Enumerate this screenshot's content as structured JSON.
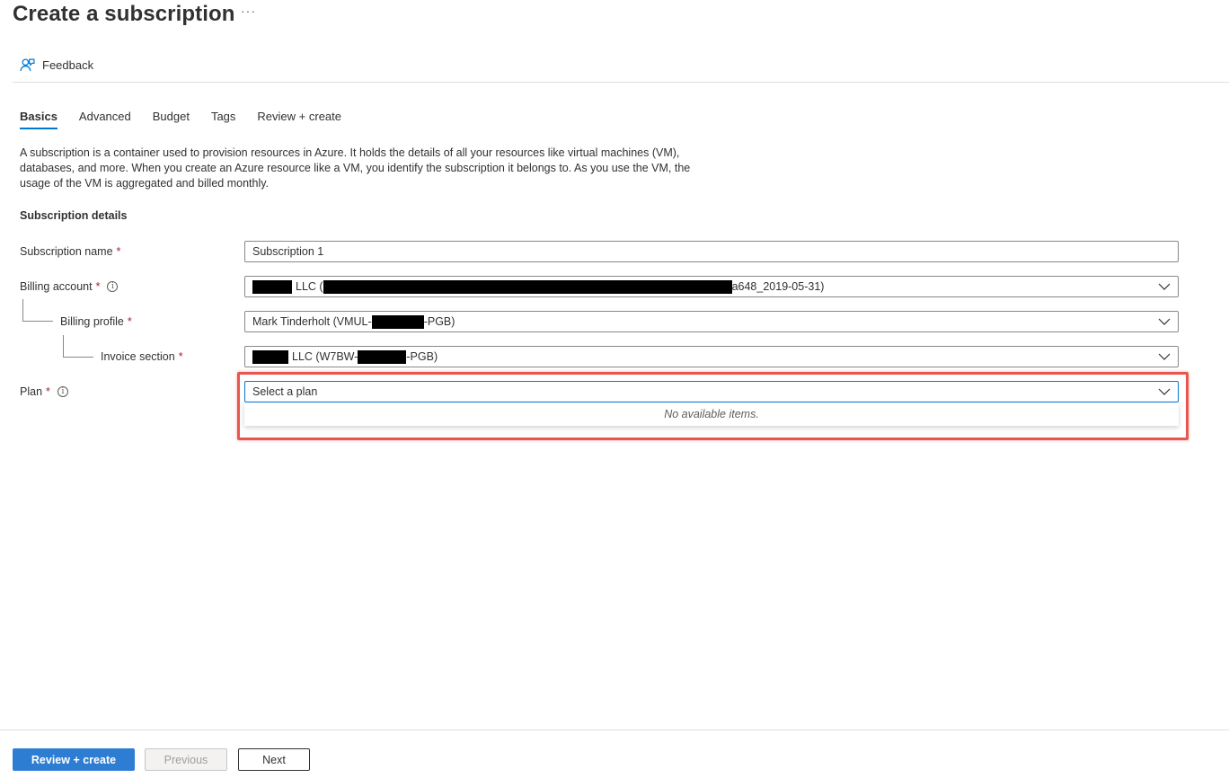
{
  "page": {
    "title": "Create a subscription",
    "more_label": "···"
  },
  "toolbar": {
    "feedback_label": "Feedback"
  },
  "tabs": [
    {
      "label": "Basics",
      "active": true
    },
    {
      "label": "Advanced",
      "active": false
    },
    {
      "label": "Budget",
      "active": false
    },
    {
      "label": "Tags",
      "active": false
    },
    {
      "label": "Review + create",
      "active": false
    }
  ],
  "description": "A subscription is a container used to provision resources in Azure. It holds the details of all your resources like virtual machines (VM), databases, and more. When you create an Azure resource like a VM, you identify the subscription it belongs to. As you use the VM, the usage of the VM is aggregated and billed monthly.",
  "section": {
    "title": "Subscription details"
  },
  "form": {
    "subscription_name": {
      "label": "Subscription name",
      "required_mark": "*",
      "value": "Subscription 1"
    },
    "billing_account": {
      "label": "Billing account",
      "required_mark": "*",
      "value_part1": "LLC (",
      "value_part2": "a648_2019-05-31)"
    },
    "billing_profile": {
      "label": "Billing profile",
      "required_mark": "*",
      "value_part1": "Mark Tinderholt (VMUL-",
      "value_part2": "-PGB)"
    },
    "invoice_section": {
      "label": "Invoice section",
      "required_mark": "*",
      "value_part1": "LLC (W7BW-",
      "value_part2": "-PGB)"
    },
    "plan": {
      "label": "Plan",
      "required_mark": "*",
      "placeholder": "Select a plan",
      "empty_message": "No available items."
    }
  },
  "footer": {
    "review_create_label": "Review + create",
    "previous_label": "Previous",
    "next_label": "Next"
  },
  "colors": {
    "accent": "#0078d4",
    "primary_button": "#2d7ed3",
    "required": "#a4262c",
    "highlight": "#e8574f"
  }
}
